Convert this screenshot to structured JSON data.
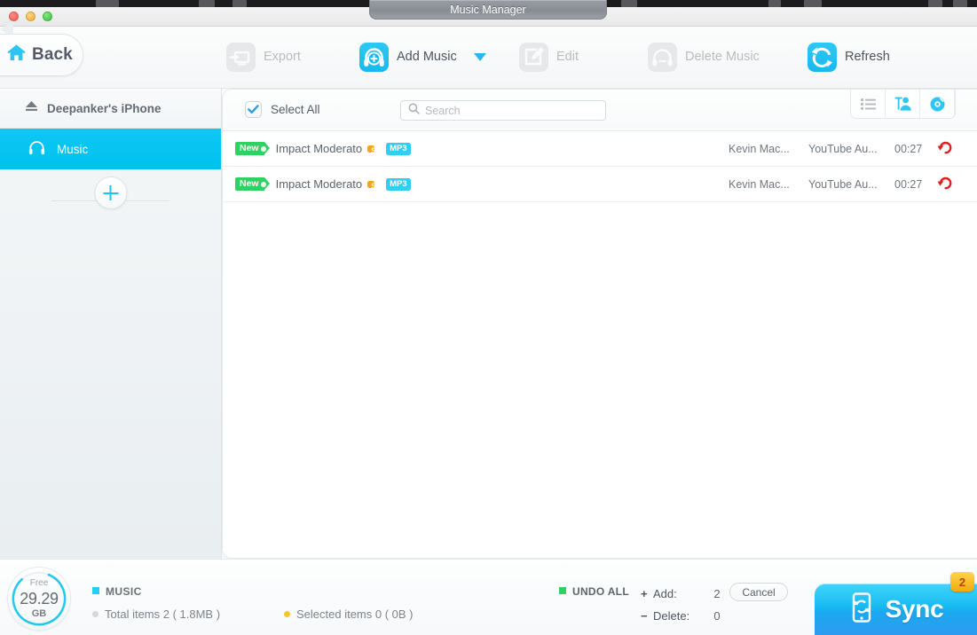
{
  "window": {
    "title": "Music Manager",
    "traffic_lights": [
      "close",
      "minimize",
      "maximize"
    ]
  },
  "toolbar": {
    "back_label": "Back",
    "items": [
      {
        "label": "Export",
        "icon": "export-icon",
        "state": "disabled"
      },
      {
        "label": "Add Music",
        "icon": "add-music-icon",
        "state": "active",
        "has_dropdown": true
      },
      {
        "label": "Edit",
        "icon": "edit-icon",
        "state": "disabled"
      },
      {
        "label": "Delete Music",
        "icon": "delete-music-icon",
        "state": "disabled"
      },
      {
        "label": "Refresh",
        "icon": "refresh-icon",
        "state": "active"
      }
    ]
  },
  "sidebar": {
    "device": "Deepanker's iPhone",
    "items": [
      {
        "label": "Music",
        "icon": "headphones-icon",
        "selected": true
      }
    ],
    "add_button": "add-category-button"
  },
  "panel": {
    "select_all_label": "Select All",
    "select_all_checked": true,
    "search": {
      "value": "",
      "placeholder": "Search"
    },
    "view_tabs": [
      {
        "name": "list-view",
        "active": false
      },
      {
        "name": "artist-view",
        "active": true
      },
      {
        "name": "album-view",
        "active": true
      }
    ],
    "tracks": [
      {
        "badge": "New",
        "title": "Impact Moderato",
        "quality": "SQ",
        "format": "MP3",
        "artist": "Kevin Mac...",
        "album": "YouTube Au...",
        "duration": "00:27",
        "action": "undo-icon"
      },
      {
        "badge": "New",
        "title": "Impact Moderato",
        "quality": "SQ",
        "format": "MP3",
        "artist": "Kevin Mac...",
        "album": "YouTube Au...",
        "duration": "00:27",
        "action": "undo-icon"
      }
    ]
  },
  "status": {
    "storage": {
      "caption": "Free",
      "value": "29.29",
      "unit": "GB",
      "percent": 82
    },
    "category_label": "MUSIC",
    "total_items": "Total items 2 ( 1.8MB )",
    "selected_items": "Selected items 0 ( 0B )",
    "undo_all_label": "UNDO ALL",
    "add_sign": "+",
    "add_label": "Add:",
    "add_count": "2",
    "delete_sign": "−",
    "delete_label": "Delete:",
    "delete_count": "0",
    "cancel_label": "Cancel",
    "sync_label": "Sync",
    "sync_badge": "2"
  },
  "colors": {
    "accent_cyan": "#00bff0",
    "badge_new_green": "#2fd163",
    "tag_sq_orange": "#f8a416",
    "tag_mp3_cyan": "#2ecef5",
    "undo_red": "#e02020",
    "sync_badge_yellow": "#f2a90d"
  }
}
